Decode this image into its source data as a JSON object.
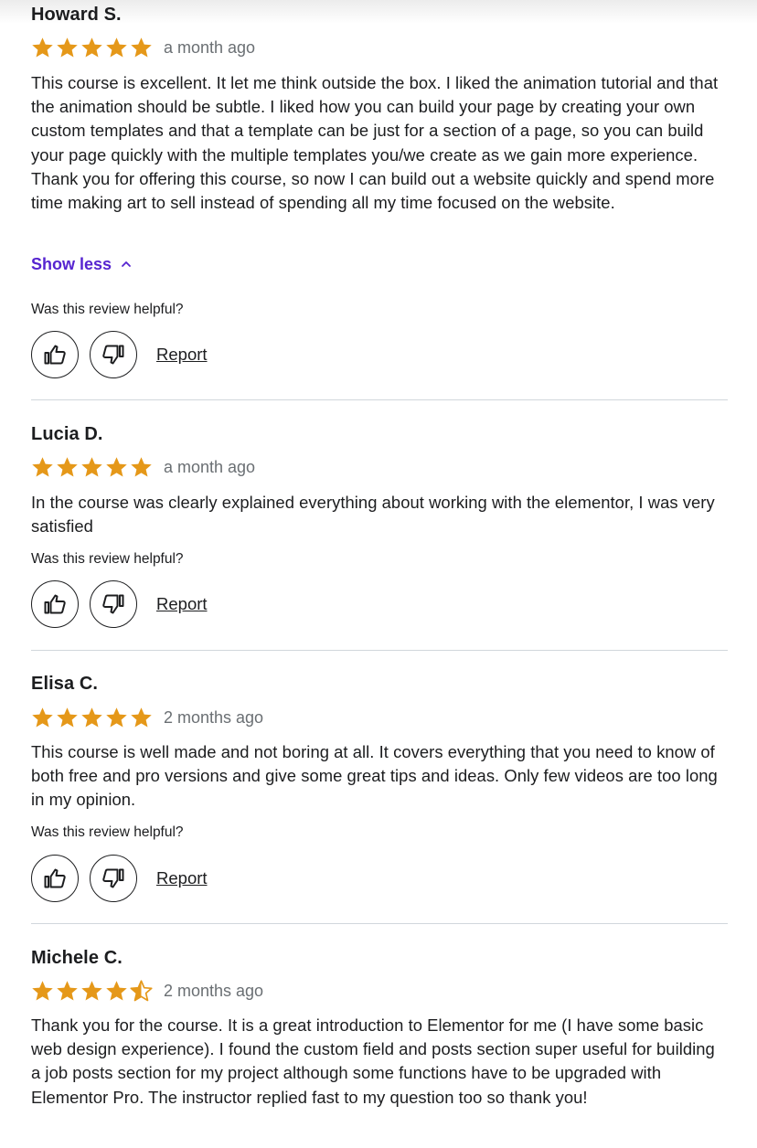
{
  "reviews": [
    {
      "name": "Howard S.",
      "rating": 5,
      "date": "a month ago",
      "text": "This course is excellent. It let me think outside the box. I liked the animation tutorial and that the animation should be subtle. I liked how you can build your page by creating your own custom templates and that a template can be just for a section of a page, so you can build your page quickly with the multiple templates you/we create as we gain more experience. Thank you for offering this course, so now I can build out a website quickly and spend more time making art to sell instead of spending all my time focused on the website.",
      "show_less_label": "Show less",
      "helpful_question": "Was this review helpful?",
      "report_label": "Report"
    },
    {
      "name": "Lucia D.",
      "rating": 5,
      "date": "a month ago",
      "text": "In the course was clearly explained everything about working with the elementor, I was very satisfied",
      "helpful_question": "Was this review helpful?",
      "report_label": "Report"
    },
    {
      "name": "Elisa C.",
      "rating": 5,
      "date": "2 months ago",
      "text": "This course is well made and not boring at all. It covers everything that you need to know of both free and pro versions and give some great tips and ideas. Only few videos are too long in my opinion.",
      "helpful_question": "Was this review helpful?",
      "report_label": "Report"
    },
    {
      "name": "Michele C.",
      "rating": 4.5,
      "date": "2 months ago",
      "text": "Thank you for the course. It is a great introduction to Elementor for me (I have some basic web design experience). I found the custom field and posts section super useful for building a job posts section for my project although some functions have to be upgraded with Elementor Pro. The instructor replied fast to my question too so thank you!"
    }
  ],
  "icons": {
    "thumbs_up": "thumbs-up-icon",
    "thumbs_down": "thumbs-down-icon",
    "star": "star-icon",
    "chevron": "chevron-up-icon"
  },
  "colors": {
    "star": "#e59819",
    "link_purple": "#5624d0",
    "text": "#1c1d1f",
    "muted": "#6a6f73",
    "divider": "#d1d7dc"
  }
}
